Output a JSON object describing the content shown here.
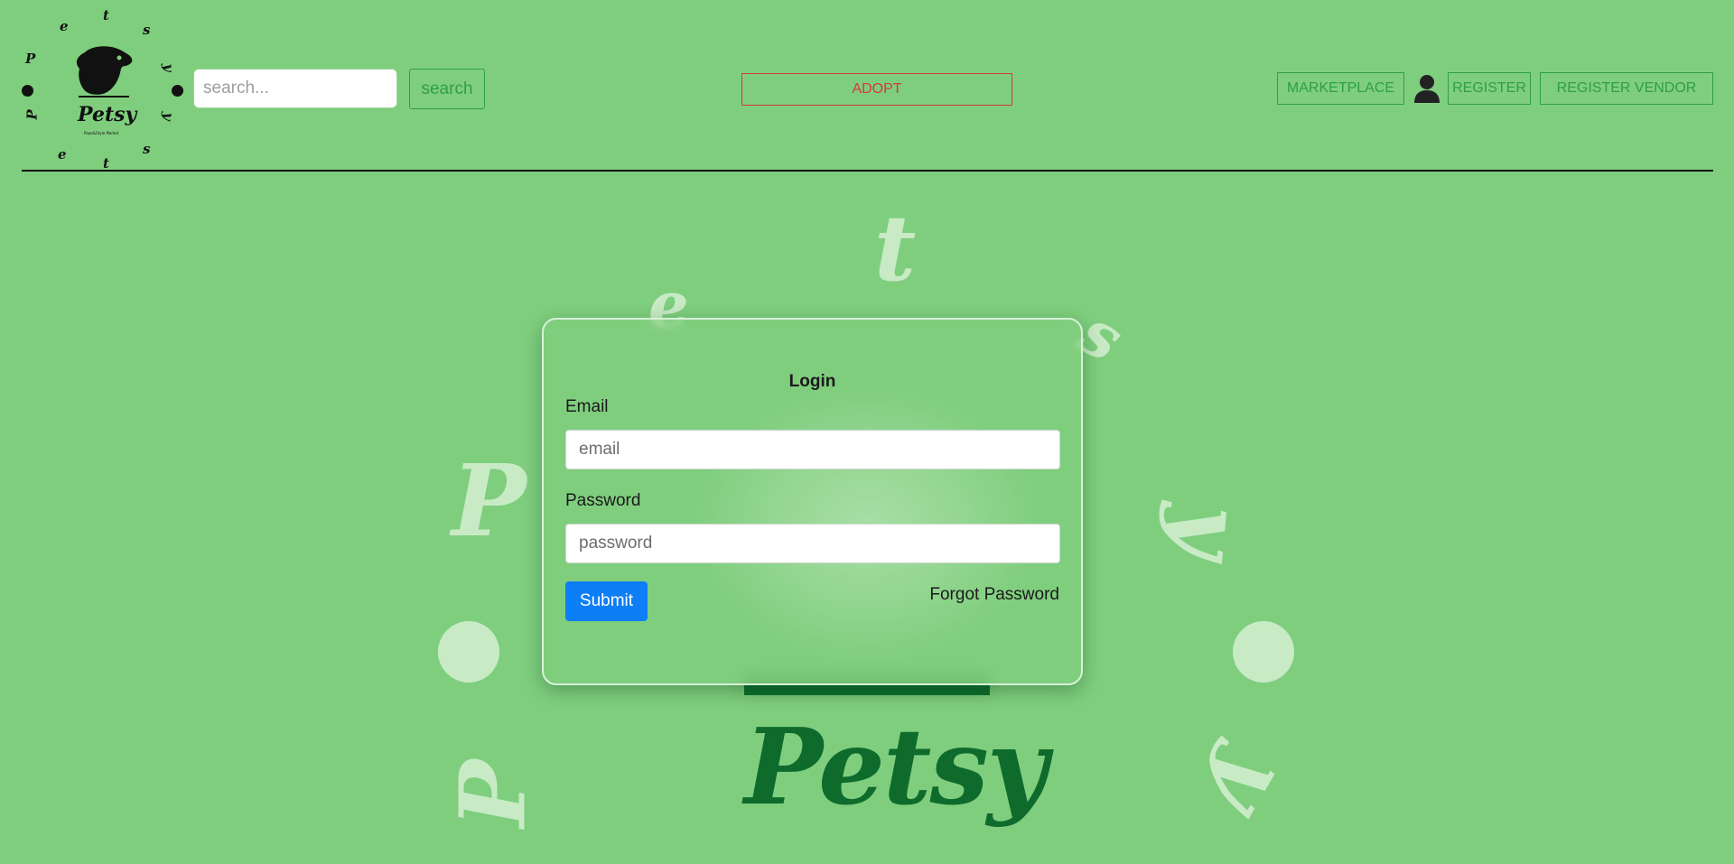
{
  "brand": {
    "name": "Petsy",
    "tagline": "Paws&Style Market",
    "ring_letters": [
      "P",
      "e",
      "t",
      "s",
      "y",
      "P",
      "e",
      "t",
      "s",
      "y"
    ]
  },
  "header": {
    "search_placeholder": "search...",
    "search_button": "search",
    "adopt_button": "ADOPT",
    "marketplace_button": "MARKETPLACE",
    "user_icon": "user-icon",
    "register_button": "REGISTER",
    "register_vendor_button": "REGISTER VENDOR"
  },
  "hero": {
    "title": "Petsy",
    "ring_letters": [
      "P",
      "e",
      "t",
      "s",
      "y",
      "P",
      "t",
      "y"
    ]
  },
  "login": {
    "title": "Login",
    "email_label": "Email",
    "email_placeholder": "email",
    "password_label": "Password",
    "password_placeholder": "password",
    "submit_button": "Submit",
    "forgot_password": "Forgot Password"
  },
  "colors": {
    "background": "#7fce7e",
    "accent_green": "#2e9e4a",
    "adopt_red": "#d33a3a",
    "submit_blue": "#0d7ef5",
    "hero_dark_green": "#0e6b2c"
  }
}
